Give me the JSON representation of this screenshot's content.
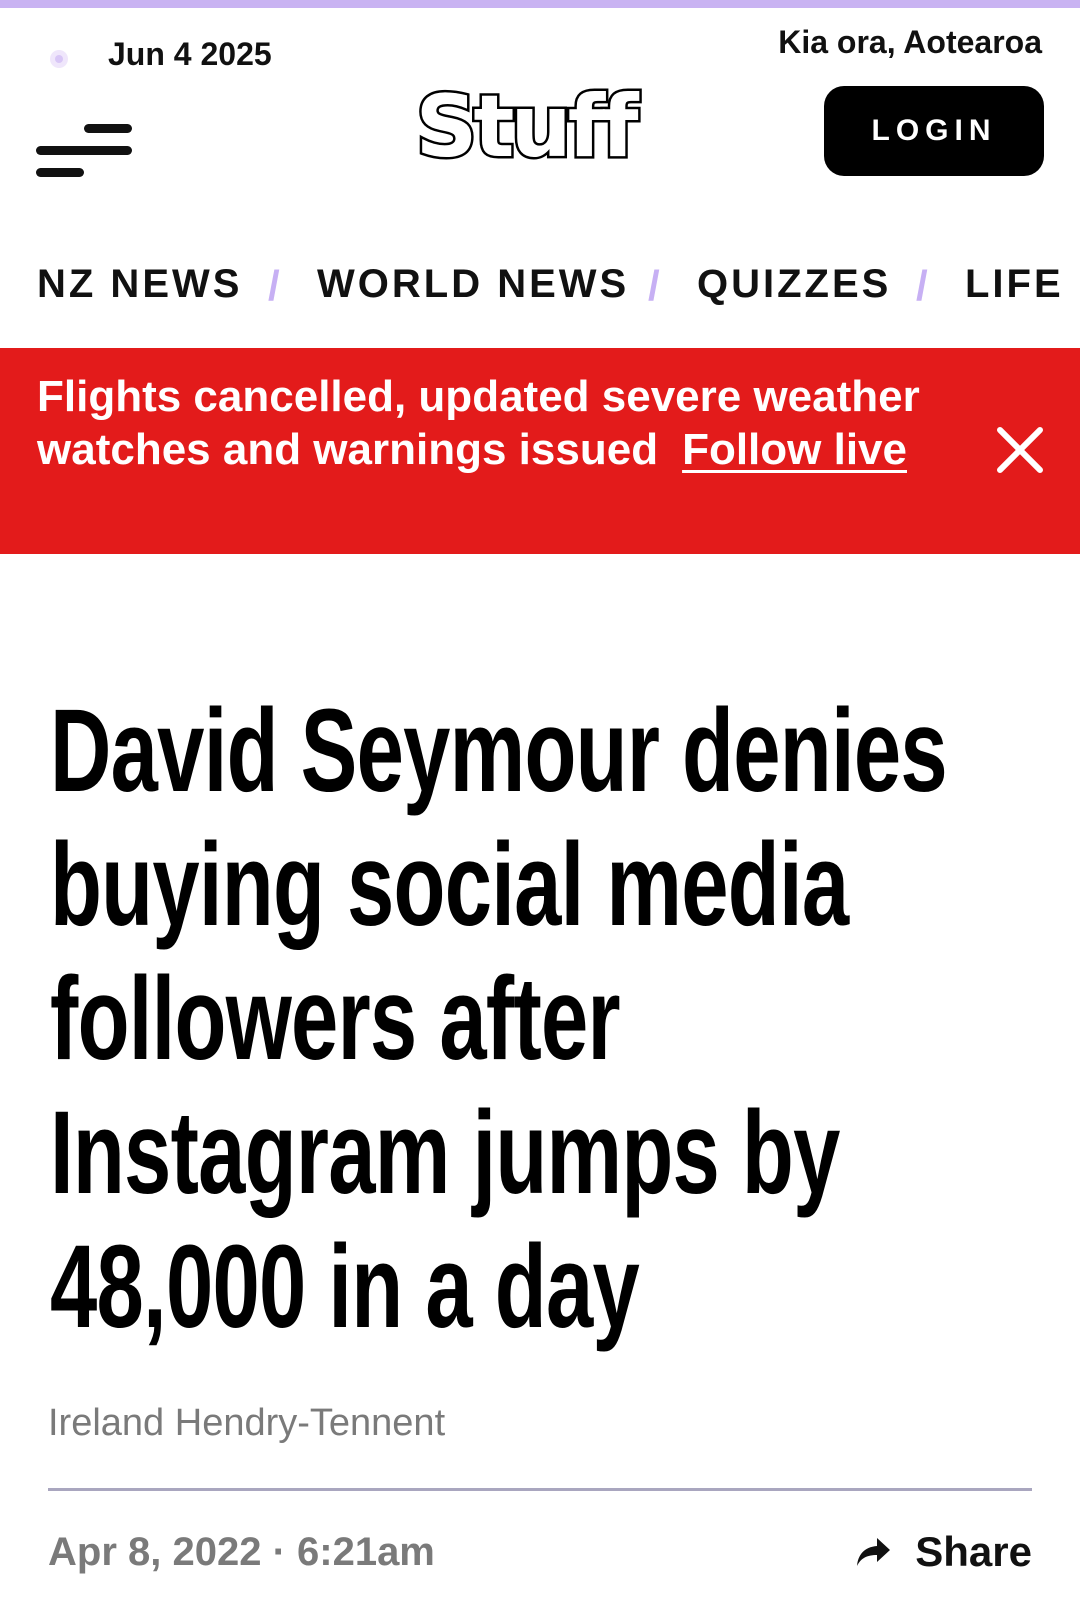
{
  "header": {
    "date": "Jun 4 2025",
    "greeting": "Kia ora, Aotearoa",
    "logo_text": "Stuff",
    "login_label": "LOGIN"
  },
  "nav": {
    "items": [
      {
        "label": "NZ NEWS"
      },
      {
        "label": "WORLD NEWS"
      },
      {
        "label": "QUIZZES"
      },
      {
        "label": "LIFE"
      }
    ],
    "separator": "/"
  },
  "alert": {
    "text": "Flights cancelled, updated severe weather watches and warnings issued",
    "link_label": "Follow live",
    "background_color": "#e31b1b"
  },
  "article": {
    "headline": "David Seymour denies buying social media followers after Instagram jumps by 48,000 in a day",
    "author": "Ireland Hendry-Tennent",
    "published": "Apr 8, 2022 · 6:21am",
    "share_label": "Share"
  },
  "colors": {
    "accent": "#c9b3f2",
    "alert": "#e31b1b",
    "text": "#111111",
    "muted": "#7a7a7a"
  },
  "icons": {
    "menu": "menu-icon",
    "close": "close-icon",
    "share": "share-arrow-icon"
  }
}
